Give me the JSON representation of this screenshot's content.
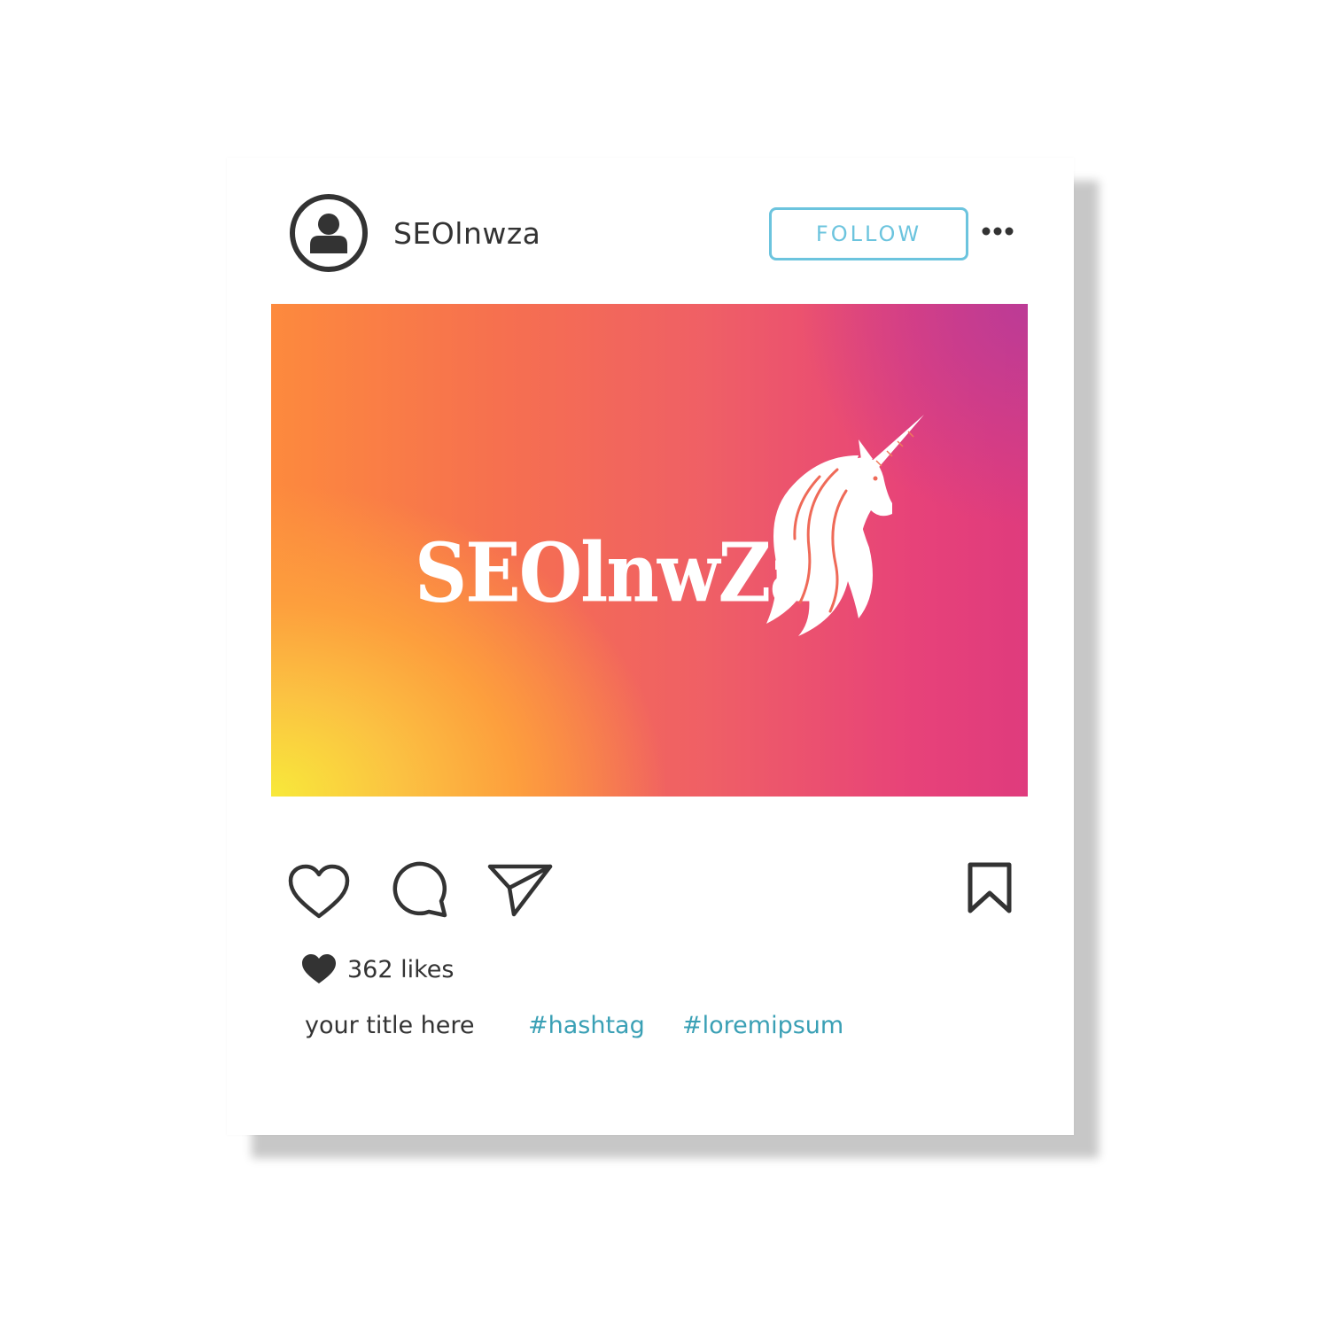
{
  "post": {
    "username": "SEOlnwza",
    "follow_label": "FOLLOW",
    "image": {
      "logo_text": "SEOlnwZa",
      "gradient_colors": [
        "#f8e93a",
        "#fd8a3d",
        "#ef5f66",
        "#e74279",
        "#bc3b96"
      ]
    },
    "likes_text": "362 likes",
    "caption": {
      "title": "your title here",
      "hashtags": [
        "#hashtag",
        "#loremipsum"
      ]
    }
  },
  "colors": {
    "accent": "#6cc4de",
    "hashtag": "#3aa0b5",
    "text": "#333333"
  },
  "icons": [
    "avatar-icon",
    "more-options-icon",
    "heart-icon",
    "comment-icon",
    "share-icon",
    "bookmark-icon",
    "likes-heart-icon",
    "unicorn-icon"
  ]
}
